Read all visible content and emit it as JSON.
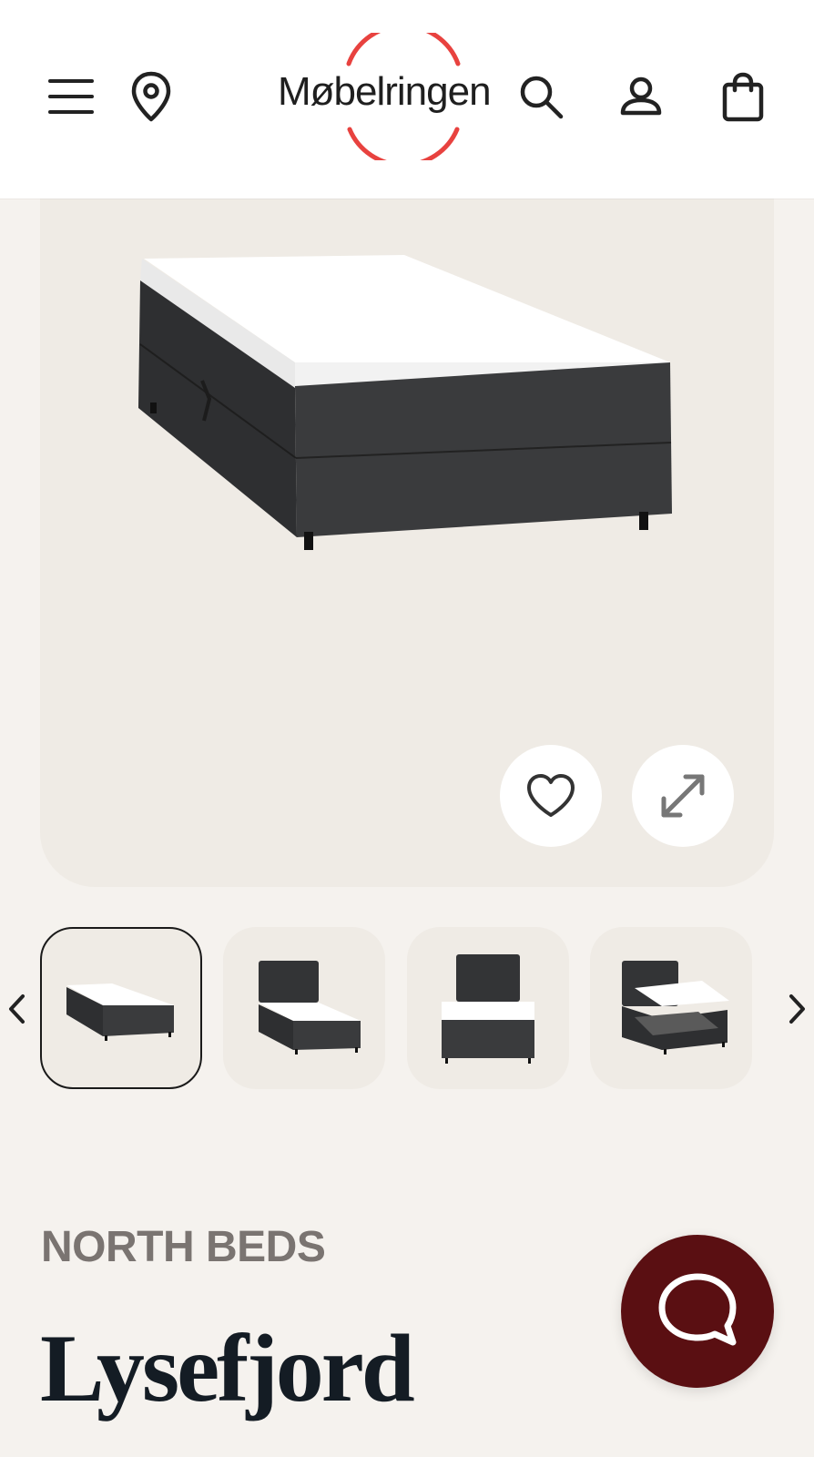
{
  "header": {
    "logo_text": "Møbelringen",
    "menu_icon": "menu-icon",
    "store_icon": "location-pin-icon",
    "search_icon": "search-icon",
    "account_icon": "user-icon",
    "cart_icon": "shopping-bag-icon",
    "accent_color": "#e8423f"
  },
  "gallery": {
    "favorite_icon": "heart-icon",
    "expand_icon": "expand-icon",
    "thumbnails": [
      {
        "view": "mattress-side",
        "active": true
      },
      {
        "view": "headboard-side",
        "active": false
      },
      {
        "view": "headboard-front",
        "active": false
      },
      {
        "view": "storage-open",
        "active": false
      }
    ],
    "prev_icon": "chevron-left-icon",
    "next_icon": "chevron-right-icon"
  },
  "product": {
    "brand": "NORTH BEDS",
    "name": "Lysefjord"
  },
  "chat": {
    "icon": "chat-bubble-icon",
    "color": "#5a0f12"
  }
}
